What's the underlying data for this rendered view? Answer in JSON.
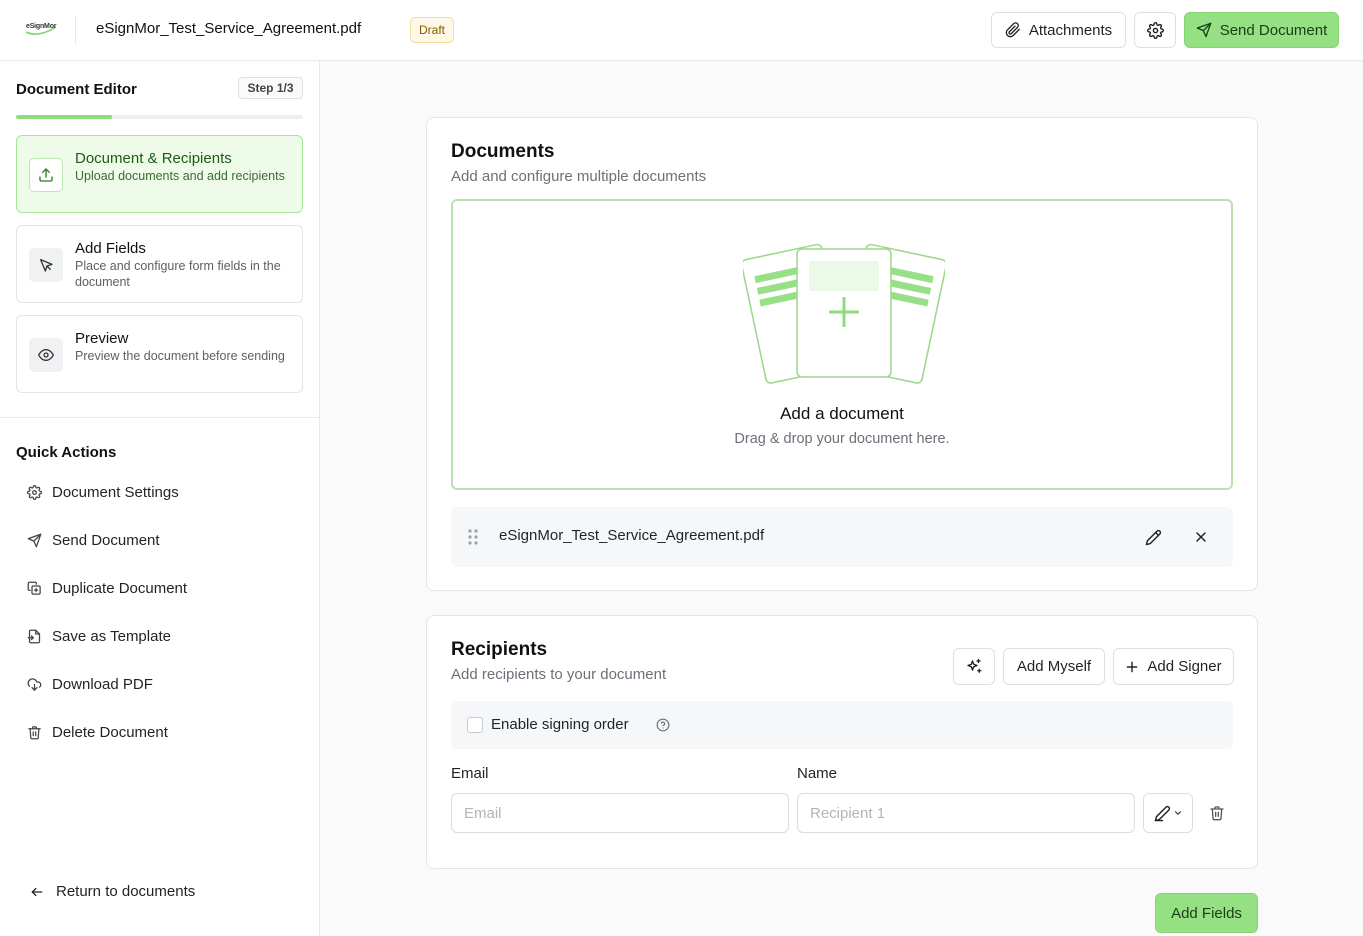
{
  "header": {
    "logo_text": "eSignMor",
    "document_name": "eSignMor_Test_Service_Agreement.pdf",
    "status_badge": "Draft",
    "attachments_label": "Attachments",
    "settings_icon": "gear-icon",
    "send_label": "Send Document"
  },
  "sidebar": {
    "title": "Document Editor",
    "step_badge": "Step 1/3",
    "progress": 0.333,
    "steps": [
      {
        "title": "Document & Recipients",
        "desc": "Upload documents and add recipients",
        "icon": "upload-icon",
        "active": true
      },
      {
        "title": "Add Fields",
        "desc": "Place and configure form fields in the document",
        "icon": "cursor-icon",
        "active": false
      },
      {
        "title": "Preview",
        "desc": "Preview the document before sending",
        "icon": "eye-icon",
        "active": false
      }
    ],
    "quick_actions_title": "Quick Actions",
    "quick_actions": [
      {
        "label": "Document Settings",
        "icon": "gear-icon"
      },
      {
        "label": "Send Document",
        "icon": "send-icon"
      },
      {
        "label": "Duplicate Document",
        "icon": "duplicate-icon"
      },
      {
        "label": "Save as Template",
        "icon": "template-icon"
      },
      {
        "label": "Download PDF",
        "icon": "download-icon"
      },
      {
        "label": "Delete Document",
        "icon": "trash-icon"
      }
    ],
    "return_label": "Return to documents"
  },
  "documents": {
    "title": "Documents",
    "subtitle": "Add and configure multiple documents",
    "dropzone_title": "Add a document",
    "dropzone_subtitle": "Drag & drop your document here.",
    "files": [
      {
        "name": "eSignMor_Test_Service_Agreement.pdf"
      }
    ]
  },
  "recipients": {
    "title": "Recipients",
    "subtitle": "Add recipients to your document",
    "add_myself_label": "Add Myself",
    "add_signer_label": "Add Signer",
    "signing_order_label": "Enable signing order",
    "signing_order_enabled": false,
    "email_label": "Email",
    "name_label": "Name",
    "rows": [
      {
        "email_value": "",
        "email_placeholder": "Email",
        "name_value": "",
        "name_placeholder": "Recipient 1",
        "role_icon": "pen-icon"
      }
    ]
  },
  "footer": {
    "next_label": "Add Fields"
  },
  "colors": {
    "accent": "#94e083",
    "accent_light": "#eefbe9",
    "draft_badge_bg": "#fef9e6",
    "draft_badge_text": "#8a5a00"
  }
}
